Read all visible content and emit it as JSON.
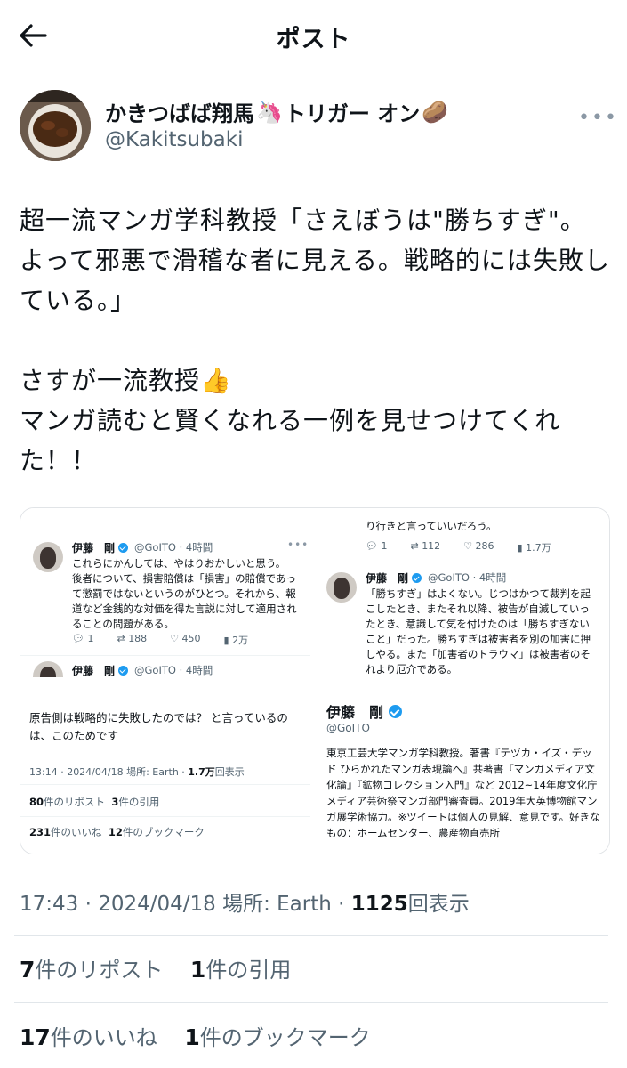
{
  "header": {
    "title": "ポスト",
    "back_icon": "arrow-left-icon"
  },
  "author": {
    "name": "かきつばば翔馬",
    "name_suffix": "トリガー オン",
    "handle": "@Kakitsubaki",
    "emoji_unicorn": "🦄",
    "emoji_potato": "🥔"
  },
  "tweet": {
    "text": "超一流マンガ学科教授「さえぼうは\"勝ちすぎ\"。よって邪悪で滑稽な者に見える。戦略的には失敗している。」\n\nさすが一流教授👍\nマンガ読むと賢くなれる一例を見せつけてくれた！！"
  },
  "images": {
    "img1": {
      "name": "伊藤　剛",
      "handle": "@GoITO · 4時間",
      "body": "これらにかんしては、やはりおかしいと思う。\n後者について、損害賠償は「損害」の賠償であって懲罰ではないというのがひとつ。それから、報道など金銭的な対価を得た言説に対して適用されることの問題がある。",
      "stats": [
        "1",
        "188",
        "450",
        "2万"
      ],
      "name2": "伊藤　剛",
      "handle2": "@GoITO · 4時間"
    },
    "img2": {
      "top_text": "り行きと言っていいだろう。",
      "top_stats": [
        "1",
        "112",
        "286",
        "1.7万"
      ],
      "name": "伊藤　剛",
      "handle": "@GoITO · 4時間",
      "body": "「勝ちすぎ」はよくない。じつはかつて裁判を起こしたとき、またそれ以降、被告が自滅していったとき、意識して気を付けたのは「勝ちすぎないこと」だった。勝ちすぎは被害者を別の加害に押しやる。また「加害者のトラウマ」は被害者のそれより厄介である。"
    },
    "img3": {
      "body": "原告側は戦略的に失敗したのでは？ と言っているのは、このためです",
      "meta": "13:14 · 2024/04/18 場所: Earth · ",
      "meta_views": "1.7万",
      "meta_views_suffix": "回表示",
      "reposts_count": "80",
      "reposts_label": "件のリポスト",
      "quotes_count": "3",
      "quotes_label": "件の引用",
      "likes_count": "231",
      "likes_label": "件のいいね",
      "bookmarks_count": "12",
      "bookmarks_label": "件のブックマーク"
    },
    "img4": {
      "name": "伊藤　剛",
      "handle": "@GoITO",
      "bio": "東京工芸大学マンガ学科教授。著書『テヅカ・イズ・デッド ひらかれたマンガ表現論へ』共著書『マンガメディア文化論』『鉱物コレクション入門』など 2012~14年度文化庁メディア芸術祭マンガ部門審査員。2019年大英博物館マンガ展学術協力。※ツイートは個人の見解、意見です。好きなもの：ホームセンター、農産物直売所"
    }
  },
  "meta": {
    "time": "17:43 · 2024/04/18 場所: Earth · ",
    "views": "1125",
    "views_suffix": "回表示"
  },
  "stats": {
    "reposts_count": "7",
    "reposts_label": "件のリポスト",
    "quotes_count": "1",
    "quotes_label": "件の引用",
    "likes_count": "17",
    "likes_label": "件のいいね",
    "bookmarks_count": "1",
    "bookmarks_label": "件のブックマーク"
  },
  "colors": {
    "accent": "#1d9bf0",
    "text": "#0f1419",
    "muted": "#536471"
  }
}
